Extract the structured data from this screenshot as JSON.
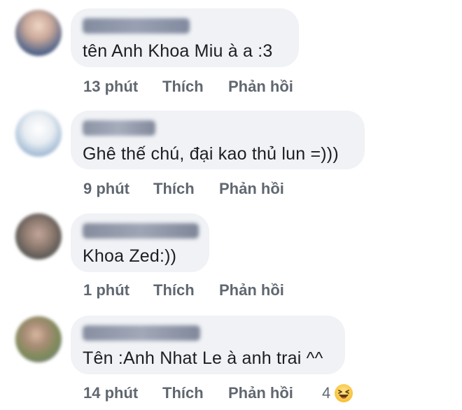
{
  "comments": [
    {
      "avatar": "user-avatar-blurred",
      "text": "tên Anh Khoa Miu à a :3",
      "time": "13 phút",
      "like": "Thích",
      "reply": "Phản hồi"
    },
    {
      "avatar": "user-avatar-blurred",
      "text": "Ghê thế chú, đại kao thủ lun =)))",
      "time": "9 phút",
      "like": "Thích",
      "reply": "Phản hồi"
    },
    {
      "avatar": "user-avatar-blurred",
      "text": "Khoa Zed:))",
      "time": "1 phút",
      "like": "Thích",
      "reply": "Phản hồi"
    },
    {
      "avatar": "user-avatar-blurred",
      "text": "Tên :Anh Nhat Le à anh trai ^^",
      "time": "14 phút",
      "like": "Thích",
      "reply": "Phản hồi",
      "reaction_count": "4",
      "reaction_icon": "haha-emoji-icon"
    }
  ],
  "colors": {
    "bubble": "#f0f2f5",
    "text": "#1c1e21",
    "meta": "#606770"
  }
}
